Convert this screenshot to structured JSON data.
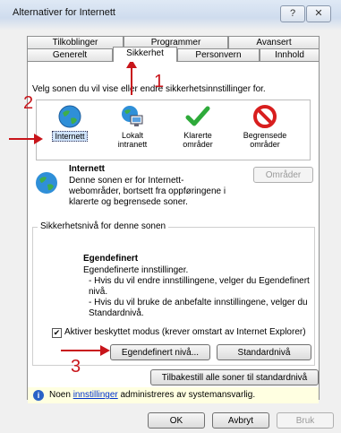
{
  "window": {
    "title": "Alternativer for Internett",
    "help_button": "?"
  },
  "tabs": {
    "row1": [
      "Tilkoblinger",
      "Programmer",
      "Avansert"
    ],
    "row2": [
      "Generelt",
      "Sikkerhet",
      "Personvern",
      "Innhold"
    ],
    "active": "Sikkerhet"
  },
  "zones_prompt": "Velg sonen du vil vise eller endre sikkerhetsinnstillinger for.",
  "zones": [
    {
      "label": "Internett",
      "icon": "globe-icon"
    },
    {
      "label": "Lokalt intranett",
      "icon": "intranet-icon"
    },
    {
      "label": "Klarerte områder",
      "icon": "checkmark-icon"
    },
    {
      "label": "Begrensede områder",
      "icon": "restricted-icon"
    }
  ],
  "zone_info": {
    "title": "Internett",
    "description": "Denne sonen er for Internett-webområder, bortsett fra oppføringene i klarerte og begrensede soner.",
    "sites_button": "Områder"
  },
  "security_level": {
    "group_label": "Sikkerhetsnivå for denne sonen",
    "level_title": "Egendefinert",
    "line1": "Egendefinerte innstillinger.",
    "line2": "- Hvis du vil endre innstillingene, velger du Egendefinert nivå.",
    "line3": "- Hvis du vil bruke de anbefalte innstillingene, velger du Standardnivå."
  },
  "protected_mode": {
    "label": "Aktiver beskyttet modus (krever omstart av Internet Explorer)",
    "checked": true
  },
  "buttons": {
    "custom_level": "Egendefinert nivå...",
    "default_level": "Standardnivå",
    "reset_all": "Tilbakestill alle soner til standardnivå",
    "ok": "OK",
    "cancel": "Avbryt",
    "apply": "Bruk"
  },
  "notice": {
    "prefix": "Noen",
    "link": "innstillinger",
    "suffix": "administreres av systemansvarlig."
  },
  "annotations": {
    "one": "1",
    "two": "2",
    "three": "3"
  },
  "colors": {
    "annotation": "#c8151b",
    "link": "#0033cc",
    "notice_bg": "#ffffe1"
  }
}
